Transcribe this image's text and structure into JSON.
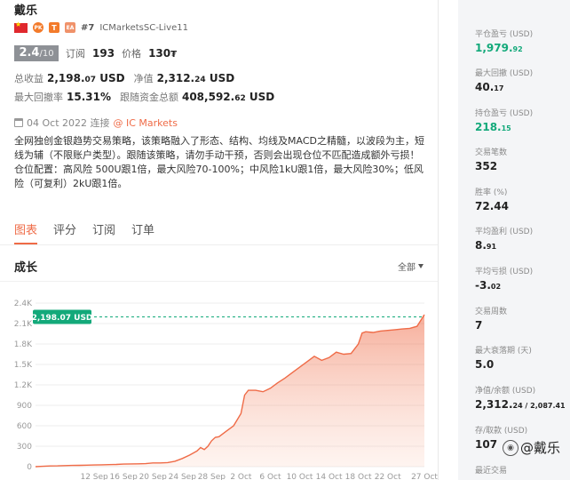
{
  "trader": {
    "name": "戴乐",
    "badge_pk": "PK",
    "badge_t": "T",
    "badge_ea": "EA",
    "rank": "#7",
    "server": "ICMarketsSC-Live11"
  },
  "rating": {
    "score": "2.4",
    "max": "/10",
    "subscribe_label": "订阅",
    "subscribe_value": "193",
    "price_label": "价格",
    "price_value": "130",
    "price_unit": "₮"
  },
  "summary": {
    "total_profit_label": "总收益",
    "total_profit_main": "2,198.",
    "total_profit_dec": "07",
    "total_profit_unit": "USD",
    "equity_label": "净值",
    "equity_main": "2,312.",
    "equity_dec": "24",
    "equity_unit": "USD",
    "drawdown_label": "最大回撤率",
    "drawdown_value": "15.31%",
    "follow_funds_label": "跟随资金总额",
    "follow_funds_main": "408,592.",
    "follow_funds_dec": "62",
    "follow_funds_unit": "USD"
  },
  "meta": {
    "date": "04 Oct 2022 连接",
    "broker": "@ IC Markets"
  },
  "description": {
    "para1": "全网独创金银趋势交易策略，该策略融入了形态、结构、均线及MACD之精髓，以波段为主，短线为辅（不限账户类型）。跟随该策略，请勿手动干预，否则会出现仓位不匹配造成额外亏损！",
    "para2": "仓位配置：高风险 500U跟1倍，最大风险70-100%；中风险1kU跟1倍，最大风险30%；低风险（可复利）2kU跟1倍。"
  },
  "tabs": [
    "图表",
    "评分",
    "订阅",
    "订单"
  ],
  "chart_section": {
    "title": "成长",
    "filter": "全部"
  },
  "chart_data": {
    "type": "area",
    "title": "",
    "xlabel": "",
    "ylabel": "",
    "y_tick_labels": [
      "0",
      "300",
      "600",
      "900",
      "1.2K",
      "1.5K",
      "1.8K",
      "2.1K",
      "2.4K"
    ],
    "y_ticks": [
      0,
      300,
      600,
      900,
      1200,
      1500,
      1800,
      2100,
      2400
    ],
    "ylim": [
      0,
      2400
    ],
    "x_tick_labels": [
      "12 Sep",
      "16 Sep",
      "20 Sep",
      "24 Sep",
      "28 Sep",
      "2 Oct",
      "6 Oct",
      "10 Oct",
      "14 Oct",
      "18 Oct",
      "22 Oct",
      "27 Oct"
    ],
    "x_ticks": [
      8,
      12,
      16,
      20,
      24,
      28,
      32,
      36,
      40,
      44,
      48,
      53
    ],
    "xlim": [
      0,
      53
    ],
    "current_label": "2,198.07 USD",
    "current_value": 2198.07,
    "grid": true,
    "colors": {
      "line": "#ef6b47",
      "fill": "#fbd3c3",
      "label_bg": "#13a97a"
    },
    "x": [
      0,
      1,
      2,
      3,
      4,
      5,
      6,
      7,
      8,
      9,
      10,
      11,
      12,
      13,
      14,
      15,
      16,
      17,
      18,
      19,
      20,
      21,
      22,
      22.5,
      23,
      23.5,
      24,
      24.5,
      25,
      26,
      27,
      28,
      28.5,
      29,
      30,
      31,
      32,
      33,
      34,
      35,
      36,
      37,
      38,
      39,
      40,
      41,
      42,
      43,
      44,
      44.5,
      45,
      46,
      47,
      48,
      49,
      50,
      51,
      52,
      53
    ],
    "y": [
      0,
      5,
      10,
      12,
      15,
      18,
      20,
      22,
      25,
      28,
      30,
      32,
      38,
      40,
      42,
      45,
      55,
      55,
      60,
      80,
      120,
      170,
      230,
      280,
      250,
      300,
      380,
      430,
      440,
      520,
      600,
      780,
      1050,
      1120,
      1120,
      1100,
      1150,
      1230,
      1300,
      1380,
      1460,
      1540,
      1620,
      1560,
      1600,
      1680,
      1650,
      1660,
      1800,
      1960,
      1980,
      1970,
      1990,
      2000,
      2010,
      2020,
      2030,
      2060,
      2230
    ]
  },
  "stats": [
    {
      "label": "平仓盈亏 (USD)",
      "main": "1,979.",
      "dec": "92",
      "green": true
    },
    {
      "label": "最大回撤 (USD)",
      "main": "40.",
      "dec": "17",
      "green": false
    },
    {
      "label": "持仓盈亏 (USD)",
      "main": "218.",
      "dec": "15",
      "green": true
    },
    {
      "label": "交易笔数",
      "main": "352",
      "dec": "",
      "green": false
    },
    {
      "label": "胜率 (%)",
      "main": "72.44",
      "dec": "",
      "green": false
    },
    {
      "label": "平均盈利 (USD)",
      "main": "8.",
      "dec": "91",
      "green": false
    },
    {
      "label": "平均亏损 (USD)",
      "main": "-3.",
      "dec": "02",
      "green": false
    },
    {
      "label": "交易周数",
      "main": "7",
      "dec": "",
      "green": false
    },
    {
      "label": "最大衰落期 (天)",
      "main": "5.0",
      "dec": "",
      "green": false
    },
    {
      "label": "净值/余额 (USD)",
      "main": "2,312.",
      "dec": "24 / 2,087.41",
      "green": false
    },
    {
      "label": "存/取款 (USD)",
      "main": "107",
      "dec": "",
      "green": false
    },
    {
      "label": "最近交易",
      "main": "",
      "dec": "",
      "green": false
    }
  ],
  "watermark": "@戴乐"
}
